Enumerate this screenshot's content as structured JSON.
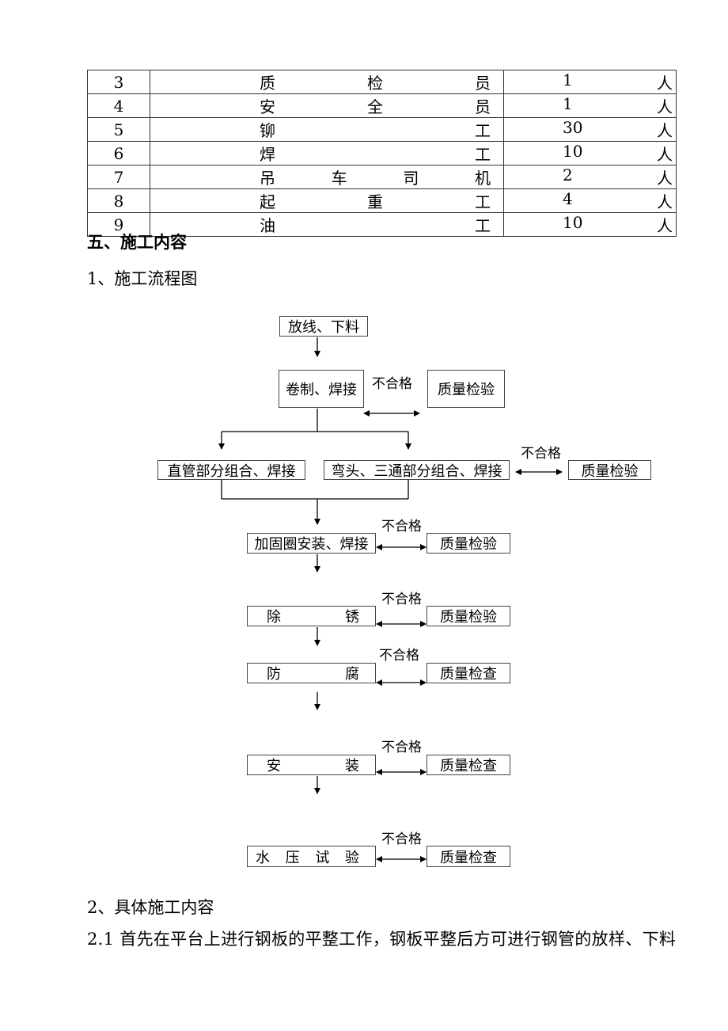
{
  "staff_table": {
    "rows": [
      {
        "no": "3",
        "role_chars": [
          "质",
          "检",
          "员"
        ],
        "count": "1",
        "unit": "人"
      },
      {
        "no": "4",
        "role_chars": [
          "安",
          "全",
          "员"
        ],
        "count": "1",
        "unit": "人"
      },
      {
        "no": "5",
        "role_chars": [
          "铆",
          "工"
        ],
        "count": "30",
        "unit": "人"
      },
      {
        "no": "6",
        "role_chars": [
          "焊",
          "工"
        ],
        "count": "10",
        "unit": "人"
      },
      {
        "no": "7",
        "role_chars": [
          "吊",
          "车",
          "司",
          "机"
        ],
        "count": "2",
        "unit": "人"
      },
      {
        "no": "8",
        "role_chars": [
          "起",
          "重",
          "工"
        ],
        "count": "4",
        "unit": "人"
      },
      {
        "no": "9",
        "role_chars": [
          "油",
          "工"
        ],
        "count": "10",
        "unit": "人"
      }
    ]
  },
  "section_heading": "五、施工内容",
  "subsection_1": "1、施工流程图",
  "flowchart": {
    "fail_label": "不合格",
    "steps": {
      "layout": "放线、下料",
      "roll_weld": "卷制、焊接",
      "straight_pipe": "直管部分组合、焊接",
      "elbow_tee": "弯头、三通部分组合、焊接",
      "ring": "加固圈安装、焊接",
      "derust": [
        "除",
        "锈"
      ],
      "anticorrosion": [
        "防",
        "腐"
      ],
      "install": [
        "安",
        "装"
      ],
      "hydro_test": [
        "水",
        "压",
        "试",
        "验"
      ]
    },
    "checks": {
      "inspection": "质量检验",
      "check": "质量检查"
    }
  },
  "subsection_2": "2、具体施工内容",
  "paragraph_2_1": "2.1  首先在平台上进行钢板的平整工作，钢板平整后方可进行钢管的放样、下料"
}
